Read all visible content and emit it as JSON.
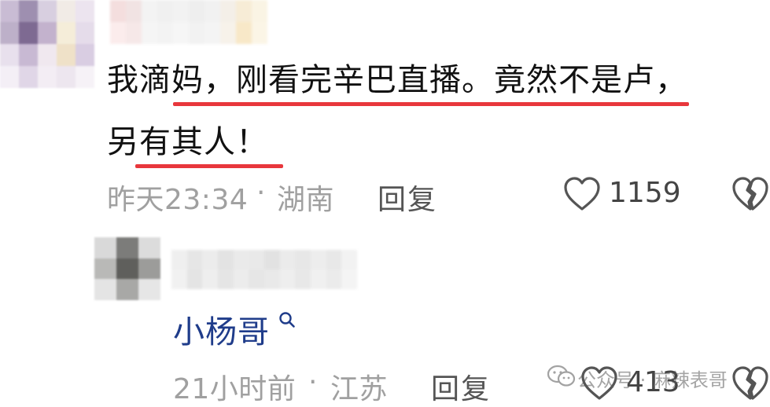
{
  "comment": {
    "line1": "我滴妈，刚看完辛巴直播。竟然不是卢，",
    "line2": "另有其人！",
    "time": "昨天23:34",
    "dot": "·",
    "location": "湖南",
    "reply_label": "回复",
    "like_count": "1159"
  },
  "reply": {
    "mention": "小杨哥",
    "time": "21小时前",
    "dot": "·",
    "location": "江苏",
    "reply_label": "回复",
    "like_count": "413"
  },
  "watermark": {
    "text": "公众号 · 麻辣表哥"
  },
  "icons": {
    "like": "heart-outline-icon",
    "dislike": "broken-heart-icon",
    "search": "search-icon",
    "wechat": "wechat-icon"
  },
  "colors": {
    "underline": "#e8373c",
    "mention": "#1f3c8a",
    "meta": "#a0a0a0"
  }
}
